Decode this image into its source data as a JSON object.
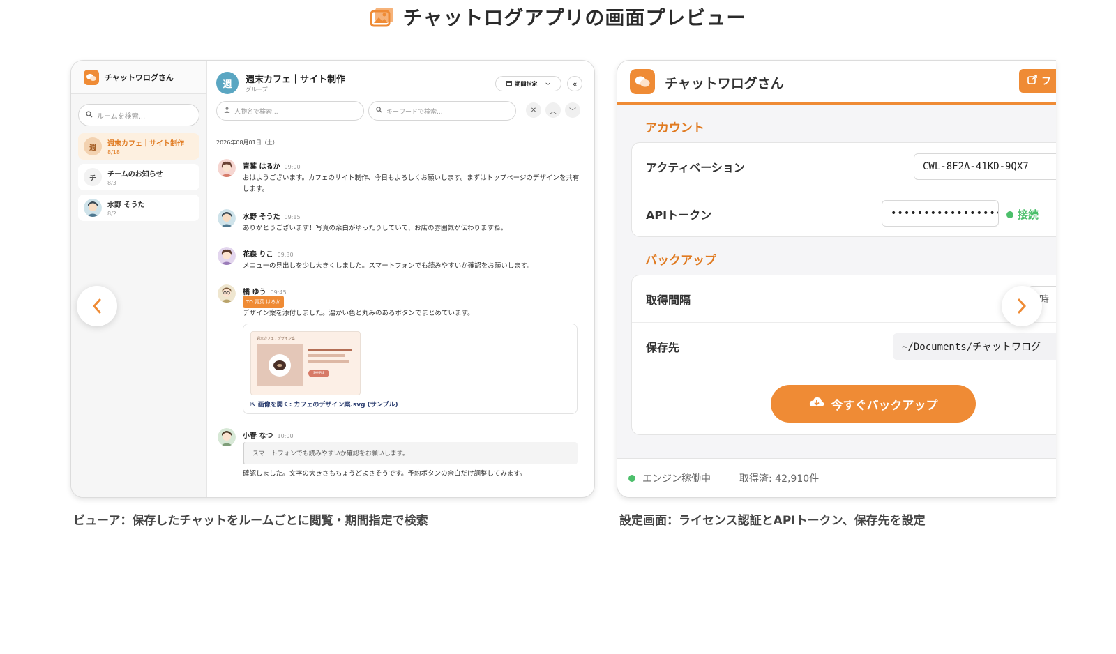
{
  "headline": {
    "title": "チャットログアプリの画面プレビュー",
    "icon": "image-icon"
  },
  "viewer": {
    "brand": "チャットワログさん",
    "room_search_placeholder": "ルームを検索...",
    "rooms": [
      {
        "avatar": "週",
        "name": "週末カフェ｜サイト制作",
        "date": "8/18"
      },
      {
        "avatar": "チ",
        "name": "チームのお知らせ",
        "date": "8/3"
      },
      {
        "avatar": "",
        "name": "水野 そうた",
        "date": "8/2"
      }
    ],
    "group": {
      "avatar": "週",
      "title": "週末カフェ｜サイト制作",
      "subtitle": "グループ"
    },
    "period_label": "期間指定",
    "person_placeholder": "人物名で検索...",
    "keyword_placeholder": "キーワードで検索...",
    "date_header": "2026年08月01日（土）",
    "messages": [
      {
        "name": "青葉 はるか",
        "time": "09:00",
        "text": "おはようございます。カフェのサイト制作、今日もよろしくお願いします。まずはトップページのデザインを共有します。"
      },
      {
        "name": "水野 そうた",
        "time": "09:15",
        "text": "ありがとうございます！写真の余白がゆったりしていて、お店の雰囲気が伝わりますね。"
      },
      {
        "name": "花森 りこ",
        "time": "09:30",
        "text": "メニューの見出しを少し大きくしました。スマートフォンでも読みやすいか確認をお願いします。"
      },
      {
        "name": "橘 ゆう",
        "time": "09:45",
        "to": "TO 青葉 はるか",
        "text": "デザイン案を添付しました。温かい色と丸みのあるボタンでまとめています。",
        "thumb_title": "週末カフェ / デザイン案",
        "thumb_btn": "SAMPLE",
        "attachment_link": "画像を開く: カフェのデザイン案.svg (サンプル)"
      },
      {
        "name": "小春 なつ",
        "time": "10:00",
        "quote": "スマートフォンでも読みやすいか確認をお願いします。",
        "text": "確認しました。文字の大きさもちょうどよさそうです。予約ボタンの余白だけ調整してみます。"
      }
    ]
  },
  "settings": {
    "brand": "チャットワログさん",
    "open_label": "フ",
    "account_title": "アカウント",
    "activation_label": "アクティベーション",
    "activation_value": "CWL-8F2A-41KD-9QX7",
    "api_label": "APIトークン",
    "api_value": "••••••••••••••••••",
    "api_status": "接続",
    "backup_title": "バックアップ",
    "interval_label": "取得間隔",
    "interval_value": "1時",
    "dest_label": "保存先",
    "dest_value": "~/Documents/チャットワログ",
    "backup_button": "今すぐバックアップ",
    "engine_status": "エンジン稼働中",
    "fetched": "取得済: 42,910件"
  },
  "captions": {
    "viewer": "ビューア：保存したチャットをルームごとに閲覧・期間指定で検索",
    "settings": "設定画面：ライセンス認証とAPIトークン、保存先を設定"
  },
  "colors": {
    "accent": "#ef8b35",
    "status_ok": "#4cbf6b"
  }
}
